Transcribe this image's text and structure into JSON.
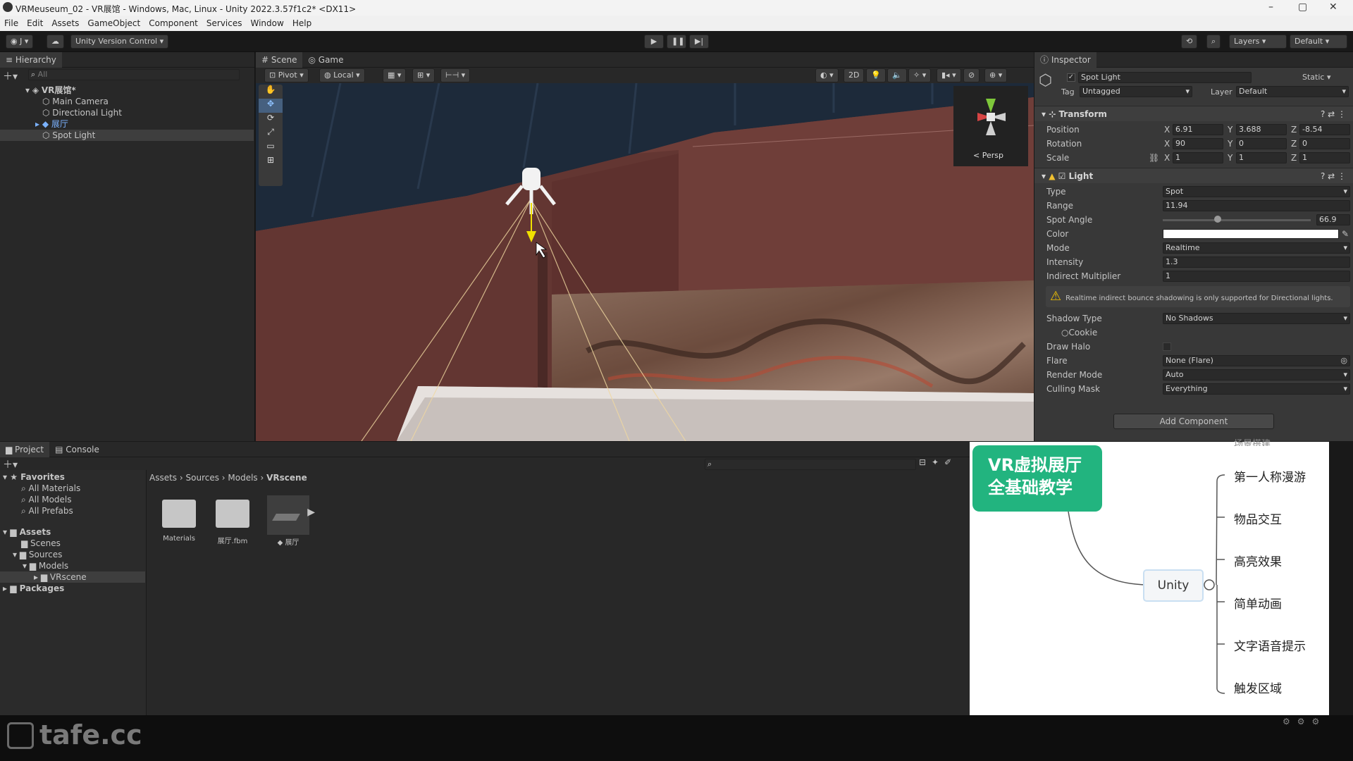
{
  "window": {
    "title": "VRMeuseum_02 - VR展馆 - Windows, Mac, Linux - Unity 2022.3.57f1c2* <DX11>"
  },
  "menu": [
    "File",
    "Edit",
    "Assets",
    "GameObject",
    "Component",
    "Services",
    "Window",
    "Help"
  ],
  "toolbar": {
    "account": "J",
    "version_control": "Unity Version Control",
    "layers": "Layers",
    "layout": "Default"
  },
  "hierarchy": {
    "title": "Hierarchy",
    "search_placeholder": "All",
    "root": "VR展馆*",
    "items": [
      "Main Camera",
      "Directional Light",
      "展厅",
      "Spot Light"
    ]
  },
  "scene": {
    "tabs": [
      "Scene",
      "Game"
    ],
    "pivot": "Pivot",
    "local": "Local",
    "mode_2d": "2D",
    "persp": "< Persp"
  },
  "inspector": {
    "title": "Inspector",
    "object_name": "Spot Light",
    "static": "Static",
    "tag_label": "Tag",
    "tag": "Untagged",
    "layer_label": "Layer",
    "layer": "Default",
    "transform": {
      "title": "Transform",
      "position_label": "Position",
      "pos_x": "6.91",
      "pos_y": "3.688",
      "pos_z": "-8.54",
      "rotation_label": "Rotation",
      "rot_x": "90",
      "rot_y": "0",
      "rot_z": "0",
      "scale_label": "Scale",
      "scale_x": "1",
      "scale_y": "1",
      "scale_z": "1"
    },
    "light": {
      "title": "Light",
      "type_label": "Type",
      "type": "Spot",
      "range_label": "Range",
      "range": "11.94",
      "spot_angle_label": "Spot Angle",
      "spot_angle": "66.9",
      "spot_angle_fraction": 0.37,
      "color_label": "Color",
      "color": "#ffffff",
      "mode_label": "Mode",
      "mode": "Realtime",
      "intensity_label": "Intensity",
      "intensity": "1.3",
      "indirect_label": "Indirect Multiplier",
      "indirect": "1",
      "warning": "Realtime indirect bounce shadowing is only supported for Directional lights.",
      "shadow_label": "Shadow Type",
      "shadow": "No Shadows",
      "cookie_label": "Cookie",
      "halo_label": "Draw Halo",
      "flare_label": "Flare",
      "flare": "None (Flare)",
      "render_label": "Render Mode",
      "render": "Auto",
      "culling_label": "Culling Mask",
      "culling": "Everything"
    },
    "add_component": "Add Component"
  },
  "project": {
    "tabs": [
      "Project",
      "Console"
    ],
    "favorites": "Favorites",
    "fav_items": [
      "All Materials",
      "All Models",
      "All Prefabs"
    ],
    "assets": "Assets",
    "asset_items": [
      "Scenes",
      "Sources",
      "Models",
      "VRscene"
    ],
    "packages": "Packages",
    "breadcrumb": [
      "Assets",
      "Sources",
      "Models",
      "VRscene"
    ],
    "files": [
      "Materials",
      "展厅.fbm",
      "展厅"
    ]
  },
  "mindmap": {
    "title": "VR虚拟展厅\n全基础教学",
    "center": "Unity",
    "top_partial": "场景搭建",
    "leaves": [
      "第一人称漫游",
      "物品交互",
      "高亮效果",
      "简单动画",
      "文字语音提示",
      "触发区域"
    ]
  },
  "watermark": "tafe.cc"
}
